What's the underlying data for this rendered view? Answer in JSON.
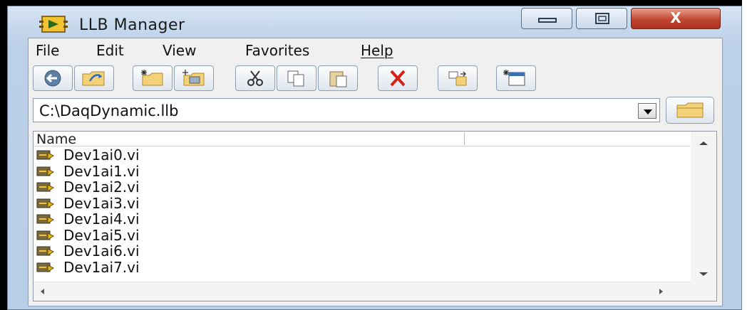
{
  "window": {
    "title": "LLB Manager",
    "buttons": {
      "minimize": "▭",
      "maximize": "▢",
      "close": "X"
    },
    "accent_close": "#c2462f"
  },
  "menu": [
    {
      "label": "File"
    },
    {
      "label": "Edit"
    },
    {
      "label": "View"
    },
    {
      "label": "Favorites"
    },
    {
      "label": "Help"
    }
  ],
  "toolbar": [
    {
      "icon": "back-icon"
    },
    {
      "icon": "up-folder-icon"
    },
    {
      "icon": "new-folder-icon"
    },
    {
      "icon": "new-library-icon"
    },
    {
      "icon": "cut-icon"
    },
    {
      "icon": "copy-icon"
    },
    {
      "icon": "paste-icon"
    },
    {
      "icon": "delete-icon"
    },
    {
      "icon": "convert-icon"
    },
    {
      "icon": "properties-icon"
    }
  ],
  "path": {
    "value": "C:\\DaqDynamic.llb"
  },
  "list": {
    "column_name": "Name",
    "files": [
      {
        "name": "Dev1ai0.vi"
      },
      {
        "name": "Dev1ai1.vi"
      },
      {
        "name": "Dev1ai2.vi"
      },
      {
        "name": "Dev1ai3.vi"
      },
      {
        "name": "Dev1ai4.vi"
      },
      {
        "name": "Dev1ai5.vi"
      },
      {
        "name": "Dev1ai6.vi"
      },
      {
        "name": "Dev1ai7.vi"
      }
    ]
  }
}
